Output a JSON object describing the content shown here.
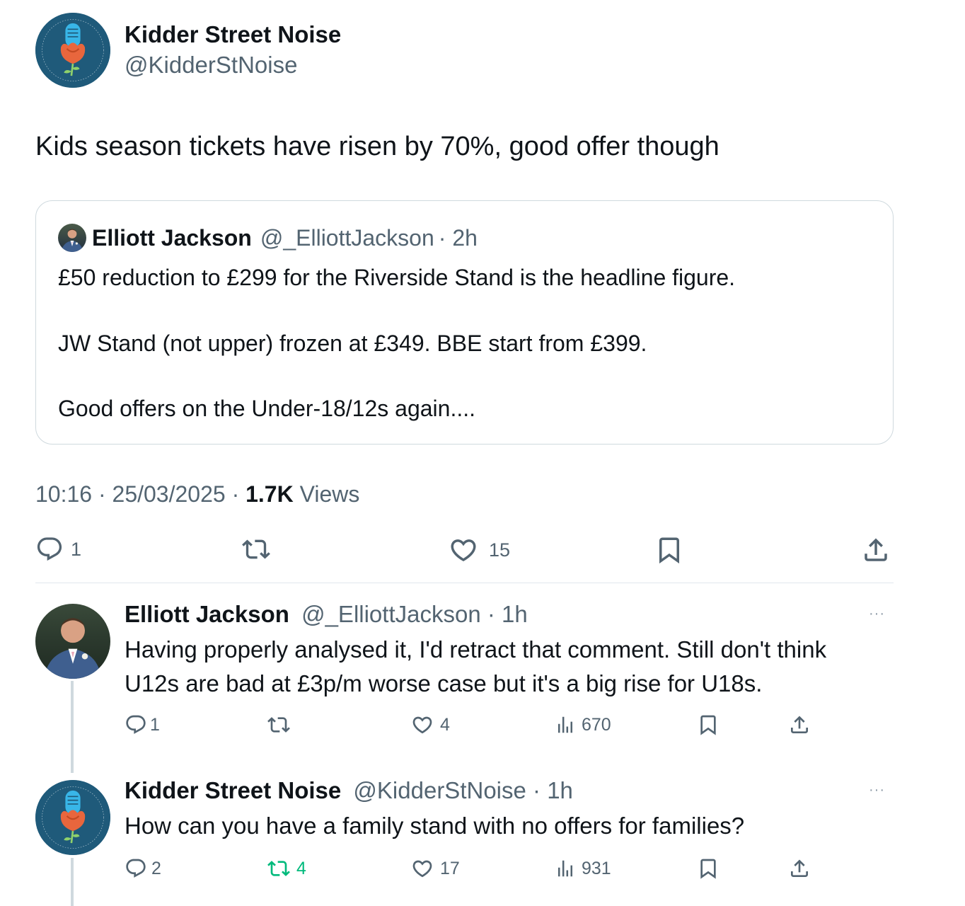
{
  "main": {
    "name": "Kidder Street Noise",
    "handle": "@KidderStNoise",
    "text": "Kids season tickets have risen by 70%, good offer though",
    "quote": {
      "name": "Elliott Jackson",
      "handle": "@_ElliottJackson",
      "time": "· 2h",
      "lines": [
        "£50 reduction to £299 for the Riverside Stand is the headline figure.",
        "JW Stand (not upper) frozen at £349. BBE start from £399.",
        "Good offers on the Under-18/12s again...."
      ]
    },
    "timestamp": "10:16 · 25/03/2025 · ",
    "views_count": "1.7K",
    "views_label": " Views",
    "actions": {
      "replies": "1",
      "likes": "15"
    }
  },
  "replies": [
    {
      "name": "Elliott Jackson",
      "handle": "@_ElliottJackson",
      "time": "· 1h",
      "more": "···",
      "lines": [
        "Having properly analysed it, I'd retract that comment. Still don't think",
        "U12s are bad at £3p/m worse case but it's a big rise for U18s."
      ],
      "actions": {
        "replies": "1",
        "retweets": "",
        "likes": "4",
        "views": "670"
      }
    },
    {
      "name": "Kidder Street Noise",
      "handle": "@KidderStNoise",
      "time": "· 1h",
      "more": "···",
      "lines": [
        "How can you have a family stand with no offers for families?"
      ],
      "actions": {
        "replies": "2",
        "retweets": "4",
        "likes": "17",
        "views": "931"
      }
    }
  ],
  "colors": {
    "text": "#0f1419",
    "muted": "#536471",
    "border": "#cfd9de",
    "retweet_active": "#00ba7c",
    "avatar_bg": "#1f5a7a",
    "logo_rose": "#e8663d",
    "logo_mic": "#38b6e8"
  },
  "icons": {
    "reply": "reply-icon",
    "retweet": "retweet-icon",
    "like": "heart-icon",
    "views": "views-icon",
    "bookmark": "bookmark-icon",
    "share": "share-icon",
    "more": "more-icon"
  }
}
